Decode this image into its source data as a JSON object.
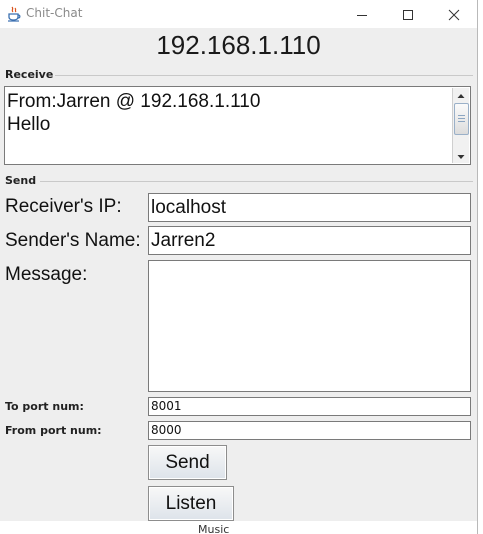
{
  "window": {
    "title": "Chit-Chat",
    "controls": [
      "minimize",
      "maximize",
      "close"
    ]
  },
  "header": {
    "ip": "192.168.1.110"
  },
  "receive": {
    "section_label": "Receive",
    "lines": [
      "From:Jarren @ 192.168.1.110",
      "Hello"
    ]
  },
  "send": {
    "section_label": "Send",
    "receiver_ip_label": "Receiver's IP:",
    "receiver_ip_value": "localhost",
    "sender_name_label": "Sender's Name:",
    "sender_name_value": "Jarren2",
    "message_label": "Message:",
    "message_value": "",
    "to_port_label": "To port num:",
    "to_port_value": "8001",
    "from_port_label": "From port num:",
    "from_port_value": "8000",
    "send_button": "Send",
    "listen_button": "Listen"
  },
  "background": {
    "taskbar_text": "Music"
  },
  "icons": {
    "app": "java-cup-icon",
    "minimize": "minimize-icon",
    "maximize": "maximize-icon",
    "close": "close-icon",
    "scroll_up": "chevron-up-icon",
    "scroll_down": "chevron-down-icon"
  },
  "colors": {
    "window_bg": "#eeeeee",
    "field_border": "#7a7a7a",
    "button_gradient_bottom": "#dde3ea"
  }
}
